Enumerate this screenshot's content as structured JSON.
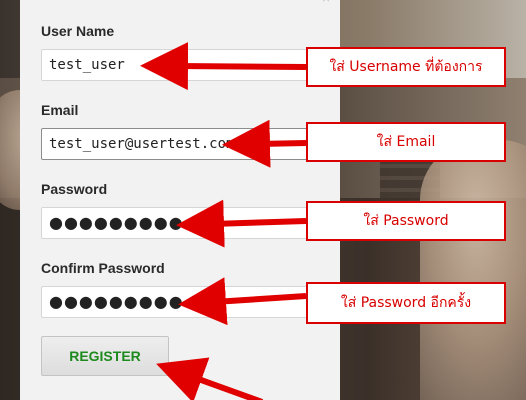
{
  "form": {
    "username_label": "User Name",
    "username_value": "test_user",
    "email_label": "Email",
    "email_value": "test_user@usertest.com",
    "password_label": "Password",
    "password_value": "●●●●●●●●●",
    "confirm_label": "Confirm Password",
    "confirm_value": "●●●●●●●●●",
    "register_label": "REGISTER",
    "close_symbol": "×"
  },
  "annotations": {
    "username_note": "ใส่ Username  ที่ต้องการ",
    "email_note": "ใส่ Email",
    "password_note": "ใส่ Password",
    "confirm_note": "ใส่ Password  อีกครั้ง"
  },
  "colors": {
    "annotation_red": "#d80000",
    "register_text": "#1d8a1d",
    "panel_bg": "#f2f2f2"
  }
}
